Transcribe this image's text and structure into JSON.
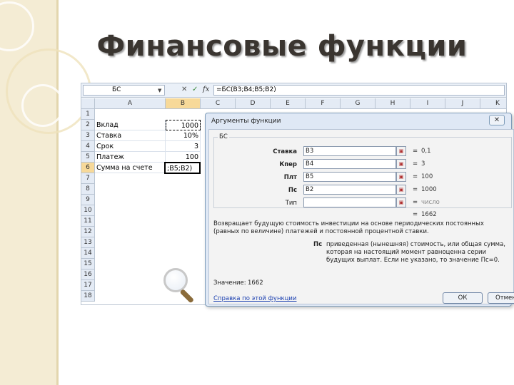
{
  "slide": {
    "title": "Финансовые функции"
  },
  "formula_bar": {
    "name_box": "БС",
    "cancel_icon": "✕",
    "enter_icon": "✓",
    "fx_icon": "fx",
    "formula": "=БС(B3;B4;B5;B2)"
  },
  "sheet": {
    "columns": [
      "A",
      "B",
      "C",
      "D",
      "E",
      "F",
      "G",
      "H",
      "I",
      "J",
      "K"
    ],
    "rows": [
      "1",
      "2",
      "3",
      "4",
      "5",
      "6",
      "7",
      "8",
      "9",
      "10",
      "11",
      "12",
      "13",
      "14",
      "15",
      "16",
      "17",
      "18"
    ],
    "cells": [
      {
        "label": "Вклад",
        "value": "1000"
      },
      {
        "label": "Ставка",
        "value": "10%"
      },
      {
        "label": "Срок",
        "value": "3"
      },
      {
        "label": "Платеж",
        "value": "100"
      },
      {
        "label": "Сумма на счете",
        "value": ";B5;B2)"
      }
    ]
  },
  "dialog": {
    "title": "Аргументы функции",
    "close_label": "✕",
    "function_name": "БС",
    "args": [
      {
        "name": "Ставка",
        "input": "B3",
        "result": "0,1"
      },
      {
        "name": "Кпер",
        "input": "B4",
        "result": "3"
      },
      {
        "name": "Плт",
        "input": "B5",
        "result": "100"
      },
      {
        "name": "Пс",
        "input": "B2",
        "result": "1000"
      },
      {
        "name": "Тип",
        "input": "",
        "result": "число"
      }
    ],
    "total": "1662",
    "description": "Возвращает будущую стоимость инвестиции на основе периодических постоянных (равных по величине) платежей и постоянной процентной ставки.",
    "param_name": "Пс",
    "param_description": "приведенная (нынешняя) стоимость, или общая сумма, которая на настоящий момент равноценна серии будущих выплат. Если не указано, то значение Пс=0.",
    "value_label": "Значение:",
    "value": "1662",
    "help_link": "Справка по этой функции",
    "ok_label": "ОК",
    "cancel_label": "Отмена"
  }
}
